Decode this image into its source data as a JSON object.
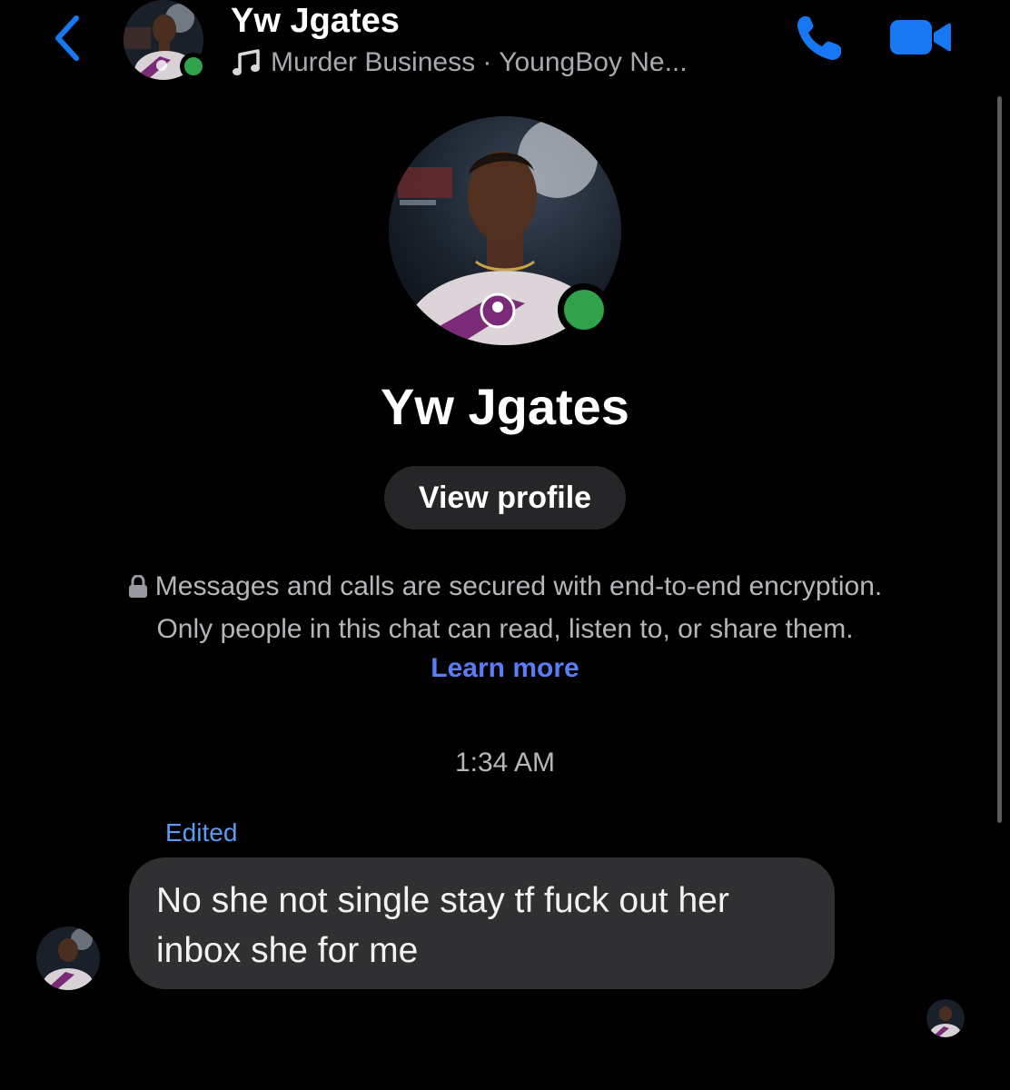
{
  "header": {
    "back_label": "Back",
    "name": "Yw Jgates",
    "now_playing": "Murder Business · YoungBoy Ne...",
    "icons": {
      "back": "chevron-left-icon",
      "music": "music-note-icon",
      "call": "phone-icon",
      "video": "video-camera-icon"
    }
  },
  "profile": {
    "name": "Yw Jgates",
    "view_profile_label": "View profile",
    "online": true
  },
  "encryption": {
    "line1": "Messages and calls are secured with end-to-end encryption.",
    "line2": "Only people in this chat can read, listen to, or share them.",
    "learn_more": "Learn more"
  },
  "conversation": {
    "timestamp": "1:34 AM",
    "messages": [
      {
        "edited_label": "Edited",
        "text": "No she not single stay tf fuck out her inbox she for me"
      }
    ]
  },
  "colors": {
    "accent_blue": "#1877f2",
    "link_blue": "#5b7cf7",
    "online_green": "#31a24c",
    "bubble_gray": "#303032"
  }
}
